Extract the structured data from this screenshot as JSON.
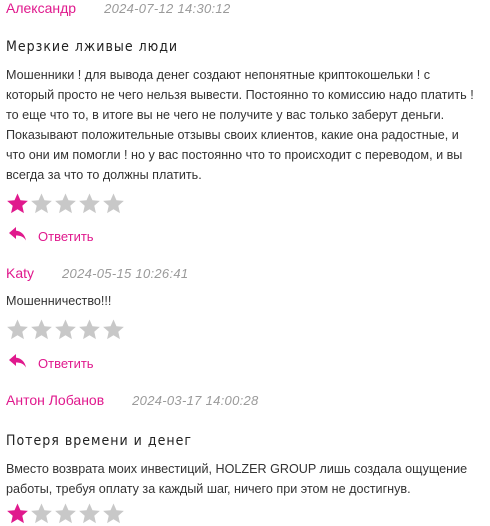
{
  "colors": {
    "accent": "#e0198d",
    "star_on": "#e0198d",
    "star_off": "#c8c8c8",
    "date": "#9a9a9a"
  },
  "reviews": [
    {
      "author": "Александр",
      "date": "2024-07-12 14:30:12",
      "title": "Мерзкие лживые люди",
      "body": "Мошенники ! для вывода денег создают непонятные криптокошельки ! с который просто не чего нельзя вывести. Постоянно то комиссию надо платить ! то еще что то, в итоге вы не чего не получите у вас только заберут деньги. Показывают положительные отзывы своих клиентов, какие она радостные, и что они им помогли ! но у вас постоянно что то происходит с переводом, и вы всегда за что то должны платить.",
      "rating": 1,
      "reply_label": "Ответить"
    },
    {
      "author": "Katy",
      "date": "2024-05-15 10:26:41",
      "title": "",
      "body": "Мошенничество!!!",
      "rating": 0,
      "reply_label": "Ответить"
    },
    {
      "author": "Антон Лобанов",
      "date": "2024-03-17 14:00:28",
      "title": "Потеря времени и денег",
      "body": "Вместо возврата моих инвестиций, HOLZER GROUP лишь создала ощущение работы, требуя оплату за каждый шаг, ничего при этом не достигнув.",
      "rating": 1,
      "reply_label": ""
    }
  ]
}
